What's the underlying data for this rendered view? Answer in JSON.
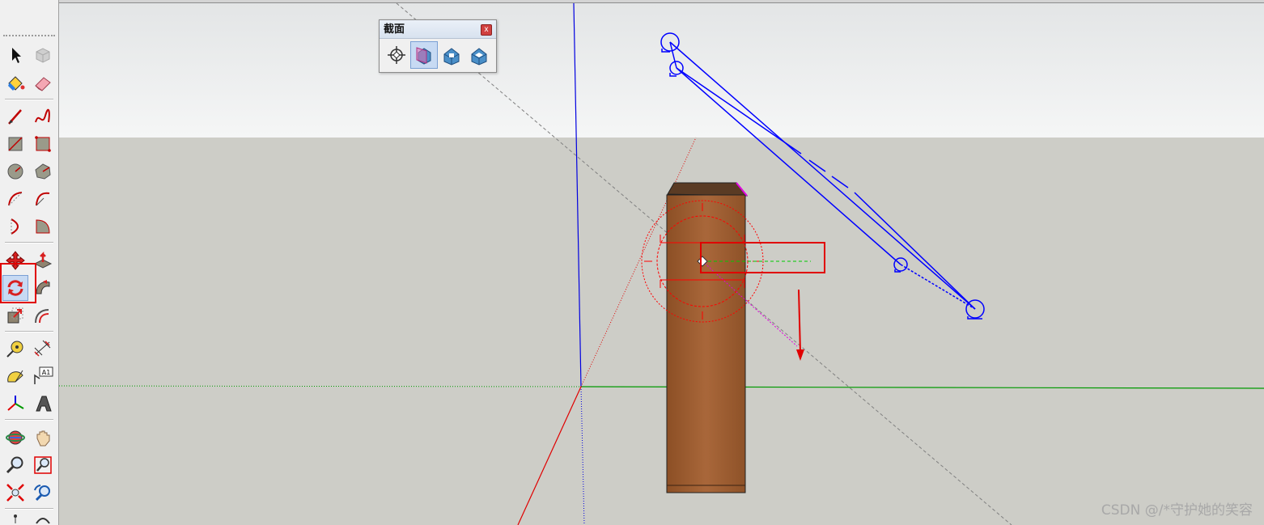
{
  "section_palette": {
    "title": "截面",
    "close_label": "x",
    "tools": [
      "section-plane-icon",
      "display-section-planes-icon",
      "display-section-cuts-icon",
      "section-fill-icon"
    ],
    "active_tool": "display-section-planes-icon"
  },
  "left_toolbar": {
    "active_tool": "rotate-icon",
    "text_tool_label": "A1",
    "tools": [
      "select-icon",
      "make-component-icon",
      "paint-bucket-icon",
      "eraser-icon",
      "line-icon",
      "freehand-icon",
      "rectangle-icon",
      "rotated-rectangle-icon",
      "circle-icon",
      "polygon-icon",
      "arc-icon",
      "two-point-arc-icon",
      "three-point-arc-icon",
      "pie-icon",
      "move-icon",
      "push-pull-icon",
      "rotate-icon",
      "follow-me-icon",
      "scale-icon",
      "offset-icon",
      "tape-measure-icon",
      "dimension-icon",
      "protractor-icon",
      "text-icon",
      "axes-icon",
      "3d-text-icon",
      "orbit-icon",
      "pan-icon",
      "zoom-icon",
      "zoom-window-icon",
      "zoom-extents-icon",
      "previous-view-icon"
    ]
  },
  "colors": {
    "axis_red": "#e00000",
    "axis_green": "#009900",
    "axis_blue": "#0000e0",
    "wood": "#9a5a2c",
    "wood_top": "#5a3b24",
    "sky": "#eff0f0",
    "ground": "#cdcdc7",
    "selection_blue": "#0000ff",
    "highlight_red": "#e00000"
  },
  "watermark": "CSDN @/*守护她的笑容"
}
